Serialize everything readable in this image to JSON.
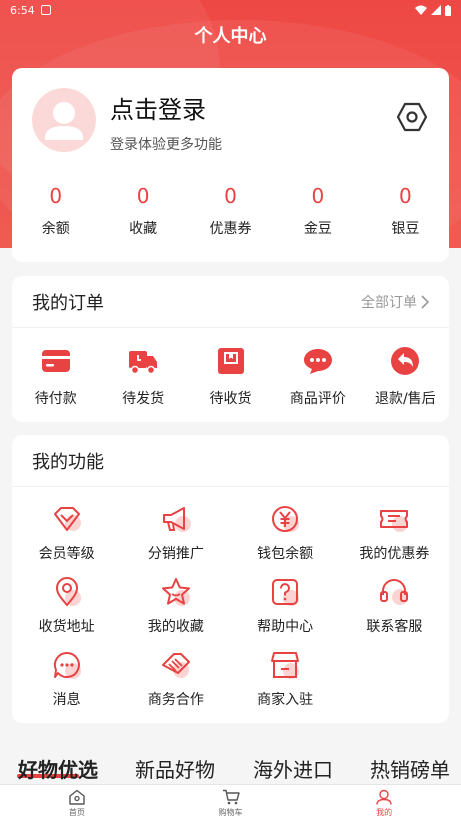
{
  "status_bar": {
    "time": "6:54"
  },
  "header": {
    "title": "个人中心"
  },
  "profile": {
    "login_title": "点击登录",
    "login_sub": "登录体验更多功能",
    "stats": [
      {
        "value": "0",
        "label": "余额"
      },
      {
        "value": "0",
        "label": "收藏"
      },
      {
        "value": "0",
        "label": "优惠券"
      },
      {
        "value": "0",
        "label": "金豆"
      },
      {
        "value": "0",
        "label": "银豆"
      }
    ]
  },
  "orders": {
    "title": "我的订单",
    "all_label": "全部订单",
    "items": [
      {
        "label": "待付款",
        "icon": "card-icon"
      },
      {
        "label": "待发货",
        "icon": "truck-icon"
      },
      {
        "label": "待收货",
        "icon": "box-icon"
      },
      {
        "label": "商品评价",
        "icon": "chat-icon"
      },
      {
        "label": "退款/售后",
        "icon": "return-icon"
      }
    ]
  },
  "functions": {
    "title": "我的功能",
    "items": [
      {
        "label": "会员等级",
        "icon": "diamond-icon"
      },
      {
        "label": "分销推广",
        "icon": "megaphone-icon"
      },
      {
        "label": "钱包余额",
        "icon": "yuan-icon"
      },
      {
        "label": "我的优惠券",
        "icon": "coupon-icon"
      },
      {
        "label": "收货地址",
        "icon": "location-icon"
      },
      {
        "label": "我的收藏",
        "icon": "star-icon"
      },
      {
        "label": "帮助中心",
        "icon": "help-icon"
      },
      {
        "label": "联系客服",
        "icon": "headset-icon"
      },
      {
        "label": "消息",
        "icon": "message-icon"
      },
      {
        "label": "商务合作",
        "icon": "handshake-icon"
      },
      {
        "label": "商家入驻",
        "icon": "store-icon"
      }
    ]
  },
  "tabs": [
    "好物优选",
    "新品好物",
    "海外进口",
    "热销磅单"
  ],
  "tabbar": [
    {
      "label": "首页",
      "icon": "home-icon"
    },
    {
      "label": "购物车",
      "icon": "cart-icon"
    },
    {
      "label": "我的",
      "icon": "user-icon"
    }
  ],
  "colors": {
    "accent": "#e84342",
    "header_bg": "#ee4844"
  }
}
